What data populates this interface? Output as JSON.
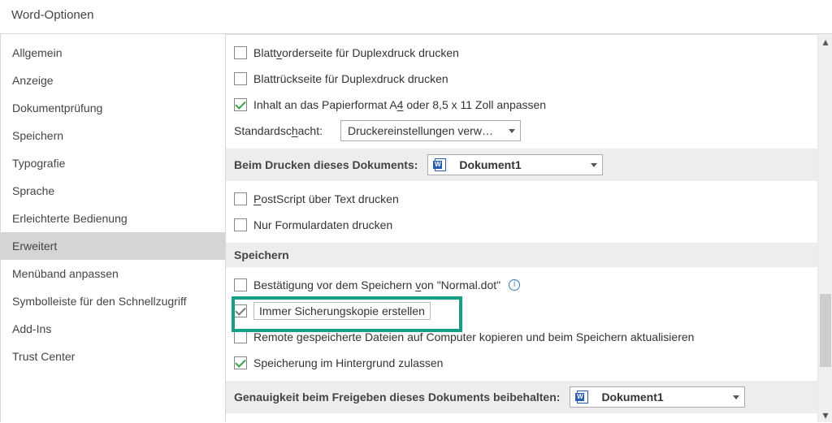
{
  "window": {
    "title": "Word-Optionen"
  },
  "sidebar": {
    "items": [
      {
        "label": "Allgemein"
      },
      {
        "label": "Anzeige"
      },
      {
        "label": "Dokumentprüfung"
      },
      {
        "label": "Speichern"
      },
      {
        "label": "Typografie"
      },
      {
        "label": "Sprache"
      },
      {
        "label": "Erleichterte Bedienung"
      },
      {
        "label": "Erweitert",
        "selected": true
      },
      {
        "label": "Menüband anpassen"
      },
      {
        "label": "Symbolleiste für den Schnellzugriff"
      },
      {
        "label": "Add-Ins"
      },
      {
        "label": "Trust Center"
      }
    ]
  },
  "print": {
    "duplex_front": {
      "pre": "Blatt",
      "u": "v",
      "post": "orderseite für Duplexdruck drucken",
      "checked": false
    },
    "duplex_back": {
      "label": "Blattrückseite für Duplexdruck drucken",
      "checked": false
    },
    "scale_a4": {
      "pre": "Inhalt an das Papierformat A",
      "u": "4",
      "post": " oder 8,5 x 11 Zoll anpassen",
      "checked": true
    },
    "tray_label": "Standardsc",
    "tray_u": "h",
    "tray_post": "acht:",
    "tray_value": "Druckereinstellungen verw…"
  },
  "print_doc": {
    "heading": "Beim Drucken dieses Dokuments:",
    "doc_name": "Dokument1",
    "postscript": {
      "u": "P",
      "post": "ostScript über Text drucken",
      "checked": false
    },
    "formdata": {
      "label": "Nur Formulardaten drucken",
      "checked": false
    }
  },
  "save": {
    "heading": "Speichern",
    "confirm_normal": {
      "pre": "Bestätigung vor dem Speichern ",
      "u": "v",
      "post": "on \"Normal.dot\"",
      "checked": false
    },
    "backup": {
      "label": "Immer Sicherungskopie erstellen",
      "checked": true
    },
    "remote_copy": {
      "label": "Remote gespeicherte Dateien auf Computer kopieren und beim Speichern aktualisieren",
      "checked": false
    },
    "background_save": {
      "label": "Speicherung im Hintergrund zulassen",
      "checked": true
    }
  },
  "fidelity": {
    "heading": "Genauigkeit beim Freigeben dieses Dokuments beibehalten:",
    "doc_name": "Dokument1"
  }
}
